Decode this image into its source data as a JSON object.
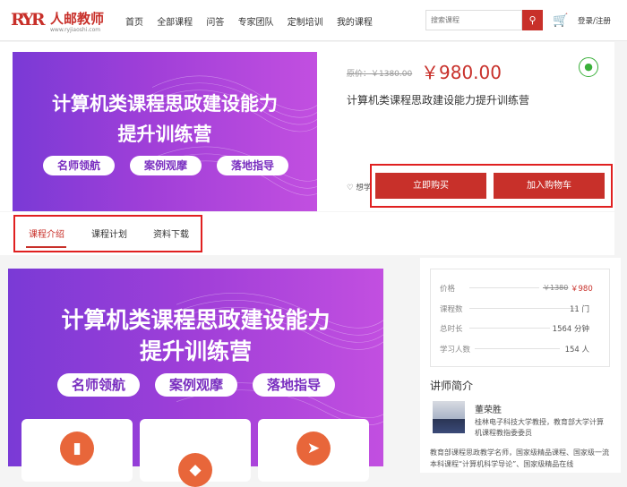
{
  "header": {
    "logo_mark": "RYR",
    "logo_text": "人邮教师",
    "logo_url": "www.ryjiaoshi.com",
    "nav": [
      "首页",
      "全部课程",
      "问答",
      "专家团队",
      "定制培训",
      "我的课程"
    ],
    "search_placeholder": "搜索课程",
    "login": "登录/注册"
  },
  "course": {
    "banner_title_1": "计算机类课程思政建设能力",
    "banner_title_2": "提升训练营",
    "banner_pills": [
      "名师领航",
      "案例观摩",
      "落地指导"
    ],
    "original_price": "原价：￥1380.00",
    "price": "￥980.00",
    "title": "计算机类课程思政建设能力提升训练营",
    "favorite": "♡ 想学",
    "buy_button": "立即购买",
    "cart_button": "加入购物车"
  },
  "tabs": [
    "课程介绍",
    "课程计划",
    "资料下载"
  ],
  "stats": {
    "price_label": "价格",
    "price_old": "￥1380",
    "price_new": "￥980",
    "rows": [
      {
        "label": "课程数",
        "value": "11 门"
      },
      {
        "label": "总时长",
        "value": "1564 分钟"
      },
      {
        "label": "学习人数",
        "value": "154 人"
      }
    ]
  },
  "teacher": {
    "heading": "讲师简介",
    "name": "董荣胜",
    "info": "桂林电子科技大学教授，教育部大学计算机课程教指委委员",
    "bio": "教育部课程思政教学名师，国家级精品课程、国家级一流本科课程“计算机科学导论”、国家级精品在线"
  },
  "colors": {
    "accent": "#c8302a",
    "banner": "#a03fd8",
    "highlight_box": "#e02020"
  }
}
